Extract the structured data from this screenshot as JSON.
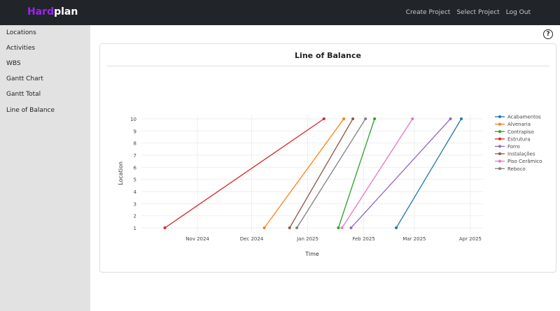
{
  "app": {
    "brand_part1": "Hard",
    "brand_part2": "plan",
    "brand_color": "#a020f0"
  },
  "topnav": {
    "create_project": "Create Project",
    "select_project": "Select Project",
    "logout": "Log Out"
  },
  "sidebar": {
    "items": [
      {
        "label": "Locations"
      },
      {
        "label": "Activities"
      },
      {
        "label": "WBS"
      },
      {
        "label": "Gantt Chart"
      },
      {
        "label": "Gantt Total"
      },
      {
        "label": "Line of Balance"
      }
    ]
  },
  "help": {
    "label": "?"
  },
  "card": {
    "title": "Line of Balance"
  },
  "chart_data": {
    "type": "line",
    "title": "Line of Balance",
    "xlabel": "Time",
    "ylabel": "Location",
    "xlim": [
      "2024-10-01",
      "2025-04-08"
    ],
    "ylim": [
      1,
      10
    ],
    "x_ticks": [
      {
        "date": "2024-11-01",
        "label": "Nov 2024"
      },
      {
        "date": "2024-12-01",
        "label": "Dec 2024"
      },
      {
        "date": "2025-01-01",
        "label": "Jan 2025"
      },
      {
        "date": "2025-02-01",
        "label": "Feb 2025"
      },
      {
        "date": "2025-03-01",
        "label": "Mar 2025"
      },
      {
        "date": "2025-04-01",
        "label": "Apr 2025"
      }
    ],
    "y_ticks": [
      "1",
      "2",
      "3",
      "4",
      "5",
      "6",
      "7",
      "8",
      "9",
      "10"
    ],
    "grid": true,
    "legend_position": "right",
    "series": [
      {
        "name": "Acabamentos",
        "color": "#1f77b4",
        "x": [
          "2025-02-19",
          "2025-03-27"
        ],
        "y": [
          1,
          10
        ]
      },
      {
        "name": "Alvenaria",
        "color": "#ff7f0e",
        "x": [
          "2024-12-08",
          "2025-01-21"
        ],
        "y": [
          1,
          10
        ]
      },
      {
        "name": "Contrapiso",
        "color": "#2ca02c",
        "x": [
          "2025-01-18",
          "2025-02-07"
        ],
        "y": [
          1,
          10
        ]
      },
      {
        "name": "Estrutura",
        "color": "#d62728",
        "x": [
          "2024-10-14",
          "2025-01-10"
        ],
        "y": [
          1,
          10
        ]
      },
      {
        "name": "Forro",
        "color": "#9467bd",
        "x": [
          "2025-01-25",
          "2025-03-21"
        ],
        "y": [
          1,
          10
        ]
      },
      {
        "name": "Instalações",
        "color": "#8c564b",
        "x": [
          "2024-12-22",
          "2025-01-26"
        ],
        "y": [
          1,
          10
        ]
      },
      {
        "name": "Piso Cerâmico",
        "color": "#e377c2",
        "x": [
          "2025-01-20",
          "2025-02-28"
        ],
        "y": [
          1,
          10
        ]
      },
      {
        "name": "Reboco",
        "color": "#7f7f7f",
        "x": [
          "2024-12-26",
          "2025-02-02"
        ],
        "y": [
          1,
          10
        ]
      }
    ]
  }
}
